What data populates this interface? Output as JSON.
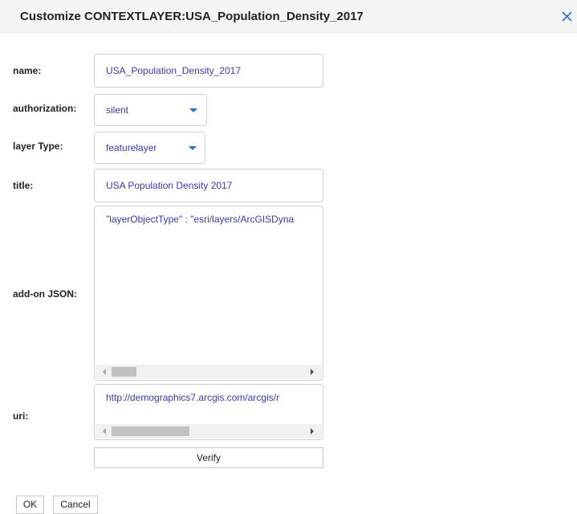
{
  "dialog": {
    "title": "Customize CONTEXTLAYER:USA_Population_Density_2017"
  },
  "form": {
    "name": {
      "label": "name:",
      "value": "USA_Population_Density_2017"
    },
    "authorization": {
      "label": "authorization:",
      "selected": "silent"
    },
    "layer_type": {
      "label": "layer Type:",
      "selected": "featurelayer"
    },
    "title": {
      "label": "title:",
      "value": "USA Population Density 2017"
    },
    "addon_json": {
      "label": "add-on JSON:",
      "value": "\"layerObjectType\" : \"esri/layers/ArcGISDyna"
    },
    "uri": {
      "label": "uri:",
      "value": "http://demographics7.arcgis.com/arcgis/r"
    },
    "verify_label": "Verify"
  },
  "footer": {
    "ok_label": "OK",
    "cancel_label": "Cancel"
  },
  "icons": {
    "close": "close-icon",
    "dropdown": "caret-down-icon",
    "scroll_left": "scroll-left-arrow-icon",
    "scroll_right": "scroll-right-arrow-icon"
  },
  "colors": {
    "header_bg": "#f5f5f5",
    "value_text": "#3a3aaf",
    "caret": "#2f6cd8",
    "close_icon": "#2f6cd8"
  }
}
